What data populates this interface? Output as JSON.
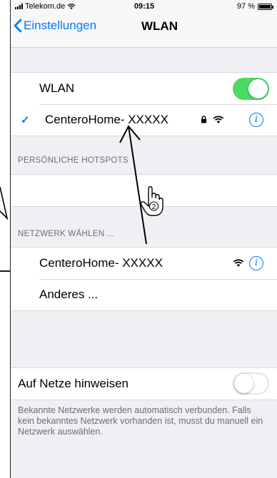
{
  "status_bar": {
    "carrier": "Telekom.de",
    "time": "09:15",
    "battery": "97 %",
    "battery_level": 0.97
  },
  "nav": {
    "back_label": "Einstellungen",
    "title": "WLAN"
  },
  "wlan_section": {
    "toggle_label": "WLAN",
    "toggle_on": true,
    "connected_network": "CenteroHome- XXXXX"
  },
  "hotspot_section": {
    "header": "PERSÖNLICHE HOTSPOTS"
  },
  "choose_section": {
    "header": "NETZWERK WÄHLEN ...",
    "networks": [
      "CenteroHome- XXXXX"
    ],
    "other_label": "Anderes ..."
  },
  "ask_section": {
    "label": "Auf Netze hinweisen",
    "toggle_on": false,
    "footer": "Bekannte Netzwerke werden automatisch verbunden. Falls kein bekanntes Netzwerk vorhanden ist, musst du manuell ein Netzwerk auswählen."
  },
  "annotation": {
    "step_number": "2"
  },
  "colors": {
    "accent": "#007aff",
    "toggle_on": "#4cd964",
    "toggle_off_border": "#e5e5ea"
  }
}
